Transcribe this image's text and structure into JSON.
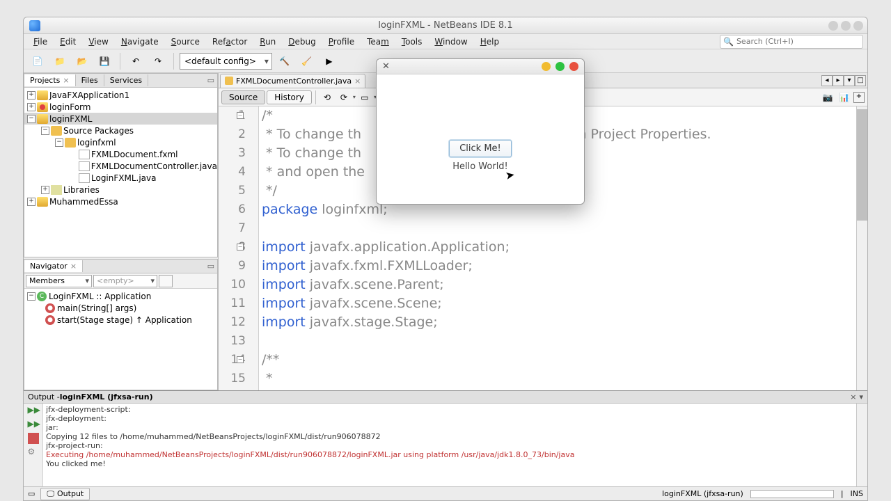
{
  "window_title": "loginFXML - NetBeans IDE 8.1",
  "menubar": [
    "File",
    "Edit",
    "View",
    "Navigate",
    "Source",
    "Refactor",
    "Run",
    "Debug",
    "Profile",
    "Team",
    "Tools",
    "Window",
    "Help"
  ],
  "search_placeholder": "Search (Ctrl+I)",
  "config_combo": "<default config>",
  "projects_tabs": {
    "projects": "Projects",
    "files": "Files",
    "services": "Services"
  },
  "project_tree": {
    "p1": "JavaFXApplication1",
    "p2": "loginForm",
    "p3": "loginFXML",
    "p3_src": "Source Packages",
    "p3_pkg": "loginfxml",
    "p3_f1": "FXMLDocument.fxml",
    "p3_f2": "FXMLDocumentController.java",
    "p3_f3": "LoginFXML.java",
    "p3_lib": "Libraries",
    "p4": "MuhammedEssa"
  },
  "navigator_title": "Navigator",
  "members_label": "Members",
  "empty_label": "<empty>",
  "nav_tree": {
    "cls": "LoginFXML :: Application",
    "m1": "main(String[] args)",
    "m2": "start(Stage stage) ↑ Application"
  },
  "editor_tab": "FXMLDocumentController.java",
  "editor_subtabs": {
    "source": "Source",
    "history": "History"
  },
  "code": {
    "l1": "/*",
    "l2": " * To change th                                se Headers in Project Properties.",
    "l3": " * To change th                                 Templates",
    "l4": " * and open the",
    "l5": " */",
    "l6_a": "package ",
    "l6_b": "loginfxml",
    "l8_a": "import ",
    "l8_b": "javafx.application.Application",
    "l9_a": "import ",
    "l9_b": "javafx.fxml.FXMLLoader",
    "l10_a": "import ",
    "l10_b": "javafx.scene.Parent",
    "l11_a": "import ",
    "l11_b": "javafx.scene.Scene",
    "l12_a": "import ",
    "l12_b": "javafx.stage.Stage",
    "l14": "/**",
    "l15": " *"
  },
  "output_title": "Output - ",
  "output_title_bold": "loginFXML (jfxsa-run)",
  "output_lines": [
    "jfx-deployment-script:",
    "jfx-deployment:",
    "jar:",
    "Copying 12 files to /home/muhammed/NetBeansProjects/loginFXML/dist/run906078872",
    "jfx-project-run:",
    "Executing /home/muhammed/NetBeansProjects/loginFXML/dist/run906078872/loginFXML.jar using platform /usr/java/jdk1.8.0_73/bin/java",
    "You clicked me!"
  ],
  "output_tab": "Output",
  "status_right": "loginFXML (jfxsa-run)",
  "status_ins": "INS",
  "fx": {
    "button": "Click Me!",
    "label": "Hello World!"
  }
}
